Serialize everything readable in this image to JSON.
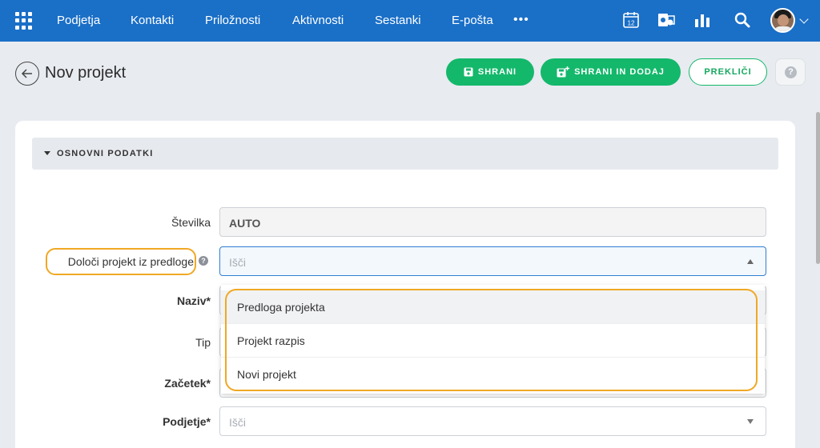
{
  "topnav": {
    "items": [
      "Podjetja",
      "Kontakti",
      "Priložnosti",
      "Aktivnosti",
      "Sestanki",
      "E-pošta"
    ],
    "more": "•••",
    "calendar_day": "12",
    "icons": [
      "apps-grid-icon",
      "calendar-icon",
      "outlook-icon",
      "reports-icon",
      "search-icon",
      "avatar",
      "chevron-down-icon"
    ]
  },
  "header": {
    "title": "Nov projekt",
    "save_label": "SHRANI",
    "save_add_label": "SHRANI IN DODAJ",
    "cancel_label": "PREKLIČI",
    "help": "?"
  },
  "section": {
    "title": "OSNOVNI PODATKI"
  },
  "form": {
    "stevilka": {
      "label": "Številka",
      "value": "AUTO"
    },
    "predloga": {
      "label": "Določi projekt iz predloge",
      "placeholder": "Išči",
      "help": "?"
    },
    "naziv": {
      "label": "Naziv*"
    },
    "tip": {
      "label": "Tip"
    },
    "zacetek": {
      "label": "Začetek*"
    },
    "podjetje": {
      "label": "Podjetje*",
      "placeholder": "Išči"
    }
  },
  "dropdown": {
    "options": [
      "Predloga projekta",
      "Projekt razpis",
      "Novi projekt"
    ]
  },
  "colors": {
    "nav": "#1a6fc7",
    "accent_green": "#14b86b",
    "highlight": "#f0a823"
  }
}
